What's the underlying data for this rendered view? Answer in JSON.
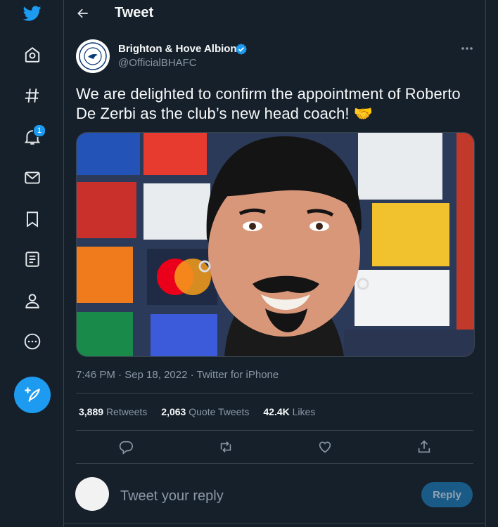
{
  "nav": {
    "items": [
      {
        "name": "twitter-logo-icon"
      },
      {
        "name": "home-icon"
      },
      {
        "name": "explore-icon"
      },
      {
        "name": "notifications-icon",
        "badge": "1"
      },
      {
        "name": "messages-icon"
      },
      {
        "name": "bookmarks-icon"
      },
      {
        "name": "lists-icon"
      },
      {
        "name": "profile-icon"
      },
      {
        "name": "more-icon"
      }
    ],
    "compose_icon": "compose-tweet-icon"
  },
  "header": {
    "title": "Tweet"
  },
  "tweet": {
    "author_name": "Brighton & Hove Albion",
    "author_handle": "@OfficialBHAFC",
    "text": "We are delighted to confirm the appointment of Roberto De Zerbi as the club’s new head coach! 🤝",
    "timestamp": "7:46 PM · Sep 18, 2022 · Twitter for iPhone",
    "retweets": "3,889",
    "retweets_label": "Retweets",
    "quotes": "2,063",
    "quotes_label": "Quote Tweets",
    "likes": "42.4K",
    "likes_label": "Likes"
  },
  "reply": {
    "placeholder": "Tweet your reply",
    "button_label": "Reply"
  },
  "colors": {
    "background": "#15202b",
    "accent": "#1d9bf0",
    "border": "#38444d",
    "muted_text": "#8b98a5"
  }
}
